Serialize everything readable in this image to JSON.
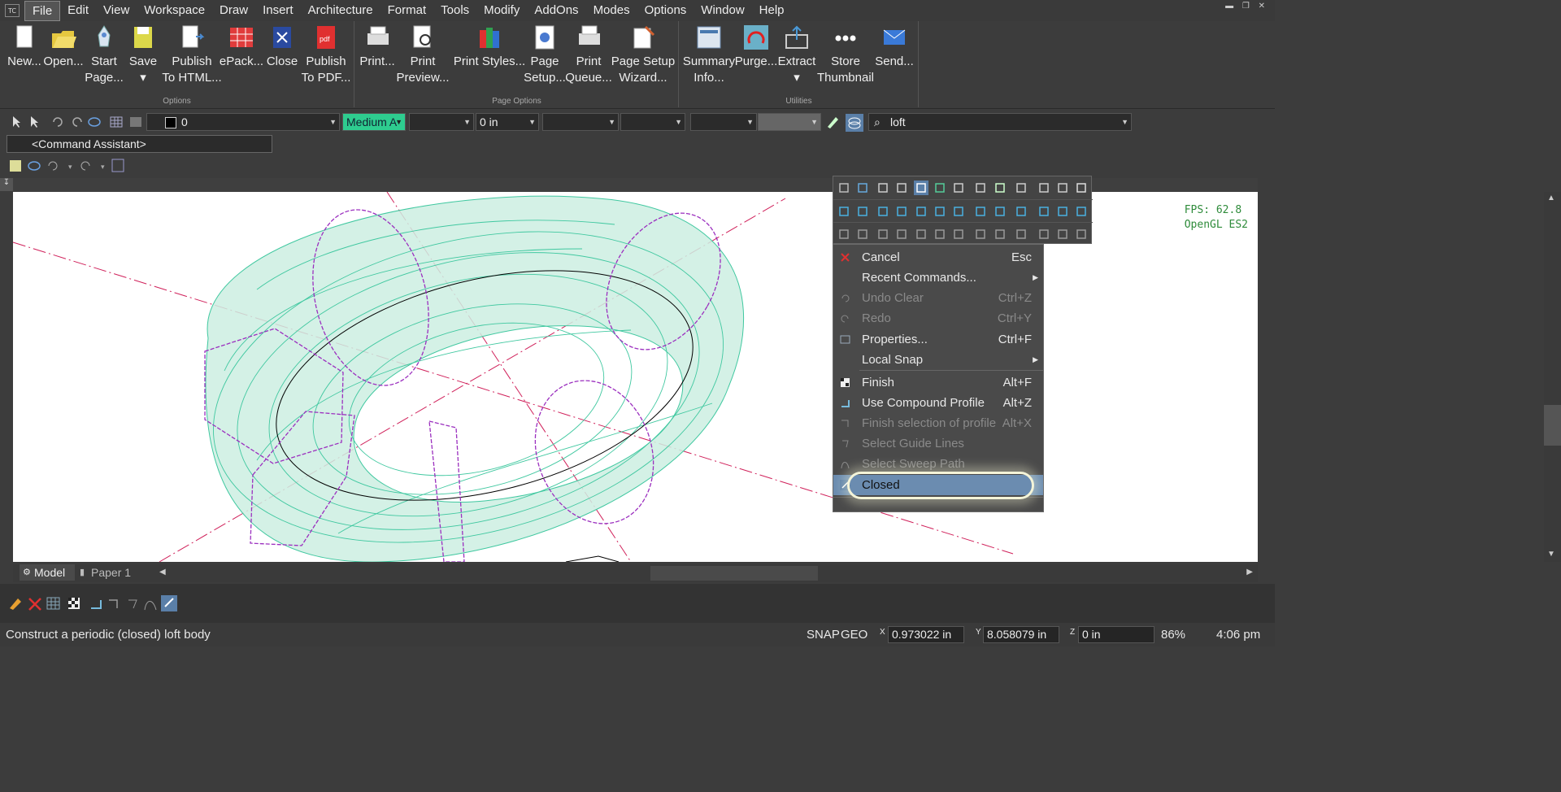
{
  "menubar": {
    "items": [
      "File",
      "Edit",
      "View",
      "Workspace",
      "Draw",
      "Insert",
      "Architecture",
      "Format",
      "Tools",
      "Modify",
      "AddOns",
      "Modes",
      "Options",
      "Window",
      "Help"
    ],
    "active": "File"
  },
  "ribbon": {
    "groups": [
      {
        "label": "Options"
      },
      {
        "label": "Page Options"
      },
      {
        "label": "Utilities"
      }
    ],
    "buttons": [
      {
        "l1": "New...",
        "l2": ""
      },
      {
        "l1": "Open...",
        "l2": ""
      },
      {
        "l1": "Start",
        "l2": "Page..."
      },
      {
        "l1": "Save",
        "l2": "▾"
      },
      {
        "l1": "Publish",
        "l2": "To HTML..."
      },
      {
        "l1": "ePack...",
        "l2": ""
      },
      {
        "l1": "Close",
        "l2": ""
      },
      {
        "l1": "Publish",
        "l2": "To PDF..."
      },
      {
        "l1": "Print...",
        "l2": ""
      },
      {
        "l1": "Print",
        "l2": "Preview..."
      },
      {
        "l1": "Print Styles...",
        "l2": ""
      },
      {
        "l1": "Page",
        "l2": "Setup..."
      },
      {
        "l1": "Print",
        "l2": "Queue..."
      },
      {
        "l1": "Page Setup",
        "l2": "Wizard..."
      },
      {
        "l1": "Summary",
        "l2": "Info..."
      },
      {
        "l1": "Purge...",
        "l2": ""
      },
      {
        "l1": "Extract",
        "l2": "▾"
      },
      {
        "l1": "Store",
        "l2": "Thumbnail"
      },
      {
        "l1": "Send...",
        "l2": ""
      }
    ]
  },
  "propbar": {
    "layer_value": "0",
    "line_weight": "Medium A",
    "offset_value": "0 in",
    "search_value": "loft"
  },
  "command_assistant": "<Command Assistant>",
  "viewport": {
    "fps": "FPS:  62.8",
    "renderer": "OpenGL ES2"
  },
  "context_menu": {
    "items": [
      {
        "label": "Cancel",
        "shortcut": "Esc",
        "disabled": false,
        "submenu": false
      },
      {
        "label": "Recent Commands...",
        "shortcut": "",
        "disabled": false,
        "submenu": true
      },
      {
        "label": "Undo Clear",
        "shortcut": "Ctrl+Z",
        "disabled": true,
        "submenu": false
      },
      {
        "label": "Redo",
        "shortcut": "Ctrl+Y",
        "disabled": true,
        "submenu": false
      },
      {
        "label": "Properties...",
        "shortcut": "Ctrl+F",
        "disabled": false,
        "submenu": false
      },
      {
        "label": "Local Snap",
        "shortcut": "",
        "disabled": false,
        "submenu": true
      },
      {
        "label": "Finish",
        "shortcut": "Alt+F",
        "disabled": false,
        "submenu": false
      },
      {
        "label": "Use Compound Profile",
        "shortcut": "Alt+Z",
        "disabled": false,
        "submenu": false
      },
      {
        "label": "Finish selection of profile",
        "shortcut": "Alt+X",
        "disabled": true,
        "submenu": false
      },
      {
        "label": "Select Guide Lines",
        "shortcut": "",
        "disabled": true,
        "submenu": false
      },
      {
        "label": "Select Sweep Path",
        "shortcut": "",
        "disabled": true,
        "submenu": false
      },
      {
        "label": "Closed",
        "shortcut": "",
        "disabled": false,
        "submenu": false
      }
    ]
  },
  "tabs": {
    "model": "Model",
    "paper": "Paper 1"
  },
  "status": {
    "prompt": "Construct a periodic (closed) loft body",
    "snap": "SNAP",
    "geo": "GEO",
    "x_label": "X",
    "x_value": "0.973022 in",
    "y_label": "Y",
    "y_value": "8.058079 in",
    "z_label": "Z",
    "z_value": "0 in",
    "zoom": "86%",
    "time": "4:06 pm"
  },
  "colors": {
    "accent": "#5a7fa8",
    "line_weight_bg": "#2ecc8f",
    "torus_fill": "#cdeee2",
    "wire": "#40c8a0",
    "profile": "#9b2fbf",
    "axis": "#d0205a"
  }
}
